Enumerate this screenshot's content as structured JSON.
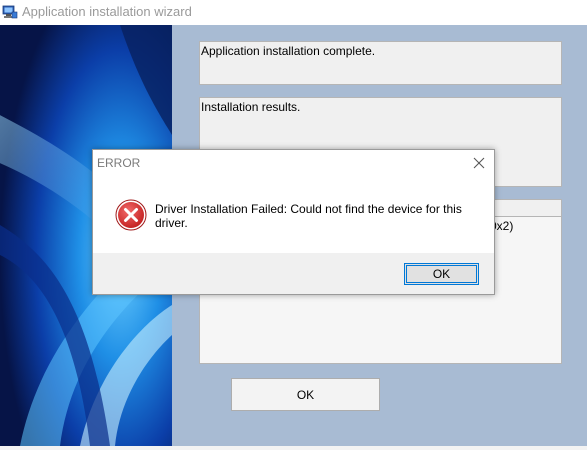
{
  "window": {
    "title": "Application installation wizard",
    "icon": "computer-setup-icon"
  },
  "main": {
    "status_text": "Application installation complete.",
    "results_text": "Installation results.",
    "log_visible_text": "0x2)",
    "ok_label": "OK"
  },
  "dialog": {
    "title": "ERROR",
    "message": "Driver Installation Failed: Could not find the  device for this driver.",
    "ok_label": "OK",
    "icon": "error-icon"
  },
  "colors": {
    "content_bg": "#a8bbd3",
    "side_panel": "#0a2a6e",
    "error_red": "#d32f2f",
    "focus_blue": "#0078d7"
  }
}
